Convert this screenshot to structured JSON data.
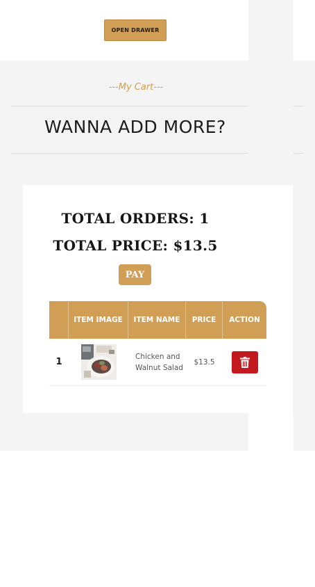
{
  "header": {
    "open_drawer_label": "OPEN DRAWER"
  },
  "cart": {
    "subtitle": "---My Cart---",
    "heading": "WANNA ADD MORE?"
  },
  "summary": {
    "total_orders": "TOTAL ORDERS: 1",
    "total_price": "TOTAL PRICE: $13.5",
    "pay_label": "PAY"
  },
  "table": {
    "columns": [
      "",
      "ITEM IMAGE",
      "ITEM NAME",
      "PRICE",
      "ACTION"
    ],
    "rows": [
      {
        "index": "1",
        "image_icon": "food-photo",
        "name": "Chicken and Walnut Salad",
        "price": "$13.5",
        "action_icon": "trash-icon"
      }
    ]
  },
  "colors": {
    "accent": "#d09f55",
    "danger": "#c21a1f",
    "background": "#f4f4f4"
  }
}
